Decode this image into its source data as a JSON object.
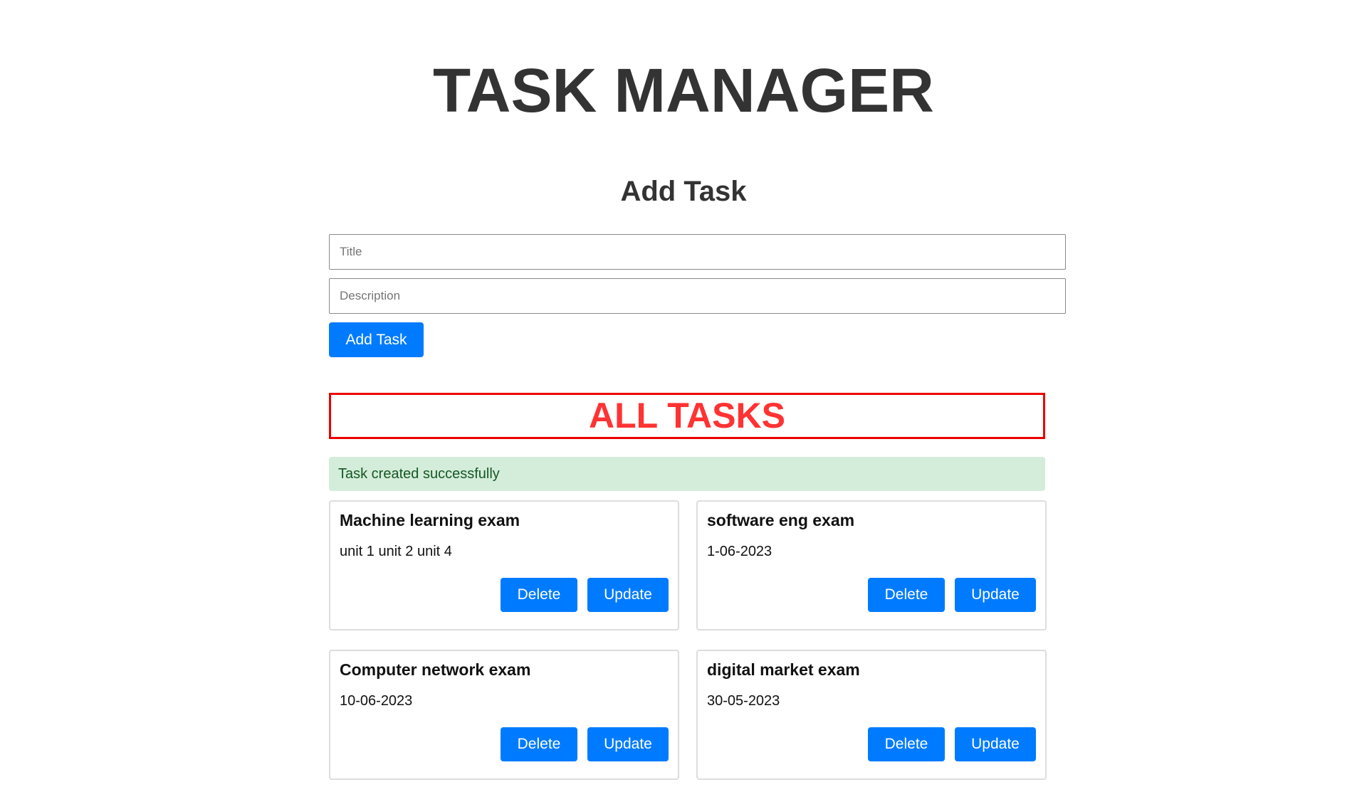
{
  "header": {
    "app_title": "TASK MANAGER"
  },
  "add_task": {
    "heading": "Add Task",
    "title_placeholder": "Title",
    "description_placeholder": "Description",
    "button_label": "Add Task"
  },
  "tasks_section": {
    "heading": "ALL TASKS",
    "alert_message": "Task created successfully"
  },
  "tasks": [
    {
      "title": "Machine learning exam",
      "description": "unit 1 unit 2 unit 4",
      "delete_label": "Delete",
      "update_label": "Update"
    },
    {
      "title": "software eng exam",
      "description": "1-06-2023",
      "delete_label": "Delete",
      "update_label": "Update"
    },
    {
      "title": "Computer network exam",
      "description": "10-06-2023",
      "delete_label": "Delete",
      "update_label": "Update"
    },
    {
      "title": "digital market exam",
      "description": "30-05-2023",
      "delete_label": "Delete",
      "update_label": "Update"
    }
  ],
  "colors": {
    "primary_button": "#007bff",
    "heading_red": "#ff3333",
    "border_red": "#ee0000",
    "alert_bg": "#d4edda",
    "alert_text": "#155724"
  }
}
